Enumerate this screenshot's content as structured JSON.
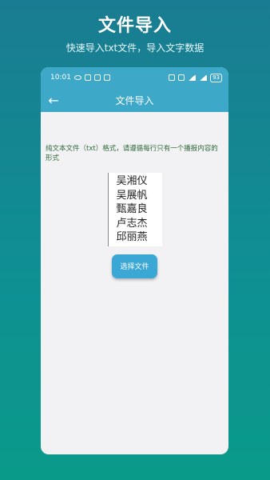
{
  "hero": {
    "title": "文件导入",
    "subtitle": "快速导入txt文件，导入文字数据"
  },
  "statusbar": {
    "time": "10:01",
    "battery": "93"
  },
  "appbar": {
    "back_icon": "arrow-left-icon",
    "title": "文件导入"
  },
  "content": {
    "description": "纯文本文件（txt）格式，请遵循每行只有一个播报内容的形式",
    "sample_lines": [
      "吴湘仪",
      "吴展帆",
      "甄嘉良",
      "卢志杰",
      "邱丽燕"
    ],
    "choose_button": "选择文件"
  },
  "colors": {
    "accent": "#3ea8c9",
    "button": "#3aa7d4",
    "description_text": "#2f6b3a"
  }
}
